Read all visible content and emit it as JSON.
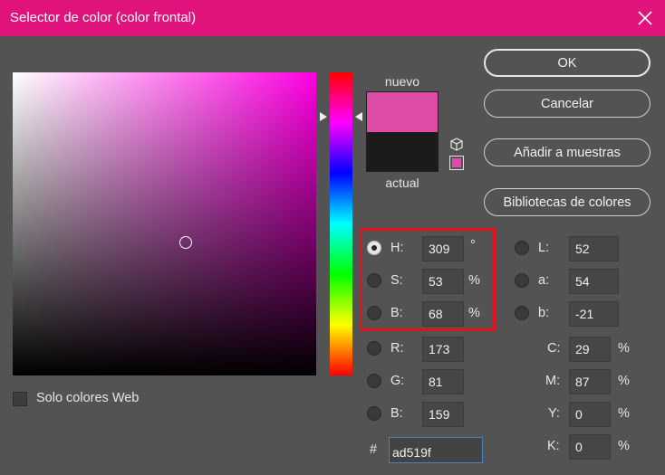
{
  "window": {
    "title": "Selector de color (color frontal)",
    "titlebar_color": "#e0137d",
    "close_icon": "close-icon"
  },
  "swatches": {
    "new_label": "nuevo",
    "current_label": "actual",
    "new_color": "#dd4da8",
    "current_color": "#1b1b1b",
    "out_of_gamut_icon": "cube-icon"
  },
  "buttons": {
    "ok": "OK",
    "cancel": "Cancelar",
    "add_to_swatches": "Añadir a muestras",
    "color_libraries": "Bibliotecas de colores"
  },
  "hsb": {
    "h_label": "H:",
    "h_value": "309",
    "h_unit": "°",
    "s_label": "S:",
    "s_value": "53",
    "s_unit": "%",
    "b_label": "B:",
    "b_value": "68",
    "b_unit": "%",
    "selected": "H"
  },
  "rgb": {
    "r_label": "R:",
    "r_value": "173",
    "g_label": "G:",
    "g_value": "81",
    "b_label": "B:",
    "b_value": "159"
  },
  "lab": {
    "l_label": "L:",
    "l_value": "52",
    "a_label": "a:",
    "a_value": "54",
    "b_label": "b:",
    "b_value": "-21"
  },
  "cmyk": {
    "c_label": "C:",
    "c_value": "29",
    "c_unit": "%",
    "m_label": "M:",
    "m_value": "87",
    "m_unit": "%",
    "y_label": "Y:",
    "y_value": "0",
    "y_unit": "%",
    "k_label": "K:",
    "k_value": "0",
    "k_unit": "%"
  },
  "hex": {
    "label": "#",
    "value": "ad519f"
  },
  "web_only": {
    "label": "Solo colores Web",
    "checked": false
  },
  "highlight_color": "#e8101a"
}
